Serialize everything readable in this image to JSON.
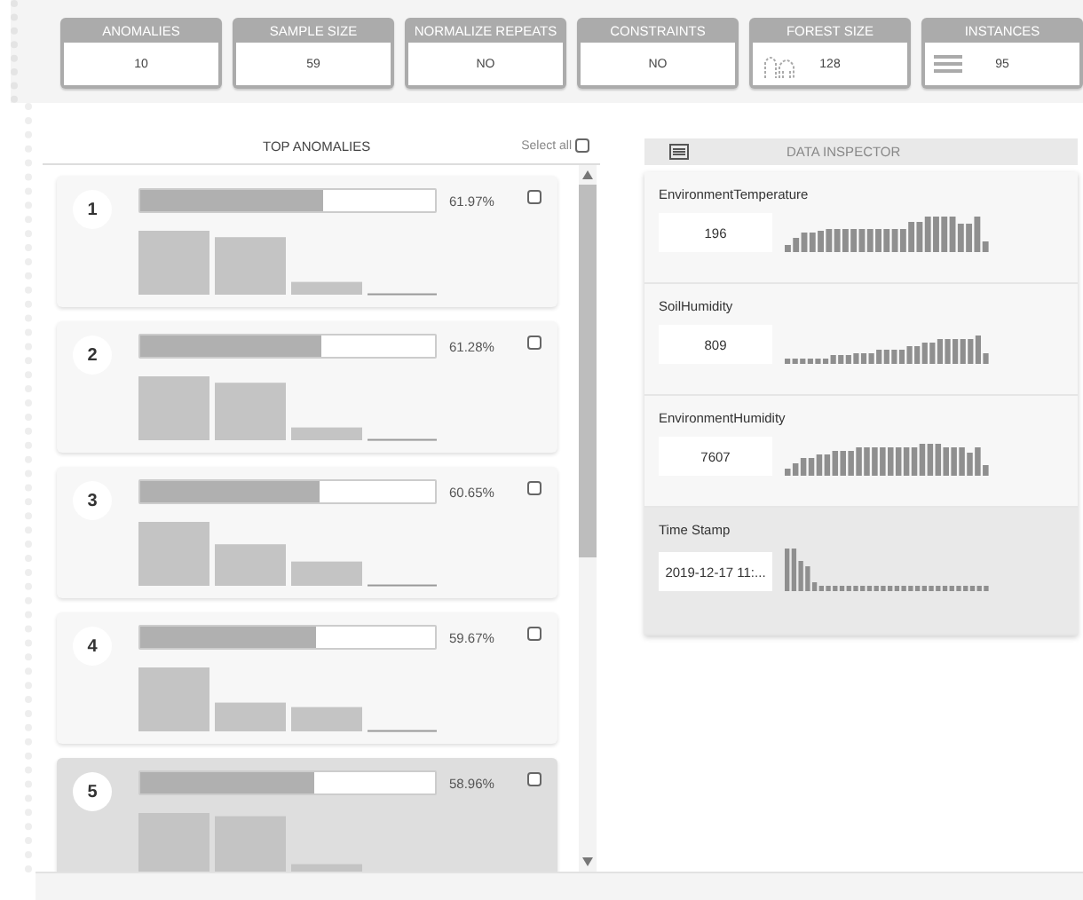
{
  "stats": [
    {
      "label": "ANOMALIES",
      "value": "10",
      "kind": "plain"
    },
    {
      "label": "SAMPLE SIZE",
      "value": "59",
      "kind": "plain"
    },
    {
      "label": "NORMALIZE REPEATS",
      "value": "NO",
      "kind": "plain"
    },
    {
      "label": "CONSTRAINTS",
      "value": "NO",
      "kind": "plain"
    },
    {
      "label": "FOREST SIZE",
      "value": "128",
      "kind": "trees"
    },
    {
      "label": "INSTANCES",
      "value": "95",
      "kind": "list"
    }
  ],
  "anomalies": {
    "title": "TOP ANOMALIES",
    "select_all": {
      "label": "Select all",
      "checked": false
    },
    "items": [
      {
        "rank": "1",
        "level": 0.6197,
        "score": "61.97%",
        "checked": false,
        "selected": false
      },
      {
        "rank": "2",
        "level": 0.6128,
        "score": "61.28%",
        "checked": false,
        "selected": false
      },
      {
        "rank": "3",
        "level": 0.6065,
        "score": "60.65%",
        "checked": false,
        "selected": false
      },
      {
        "rank": "4",
        "level": 0.5967,
        "score": "59.67%",
        "checked": false,
        "selected": false
      },
      {
        "rank": "5",
        "level": 0.5896,
        "score": "58.96%",
        "checked": false,
        "selected": true
      }
    ]
  },
  "inspector": {
    "title": "DATA INSPECTOR",
    "fields": [
      {
        "name": "EnvironmentTemperature",
        "value": "196",
        "selected": false
      },
      {
        "name": "SoilHumidity",
        "value": "809",
        "selected": false
      },
      {
        "name": "EnvironmentHumidity",
        "value": "7607",
        "selected": false
      },
      {
        "name": "Time Stamp",
        "value": "2019-12-17 11:...",
        "selected": true
      }
    ]
  }
}
